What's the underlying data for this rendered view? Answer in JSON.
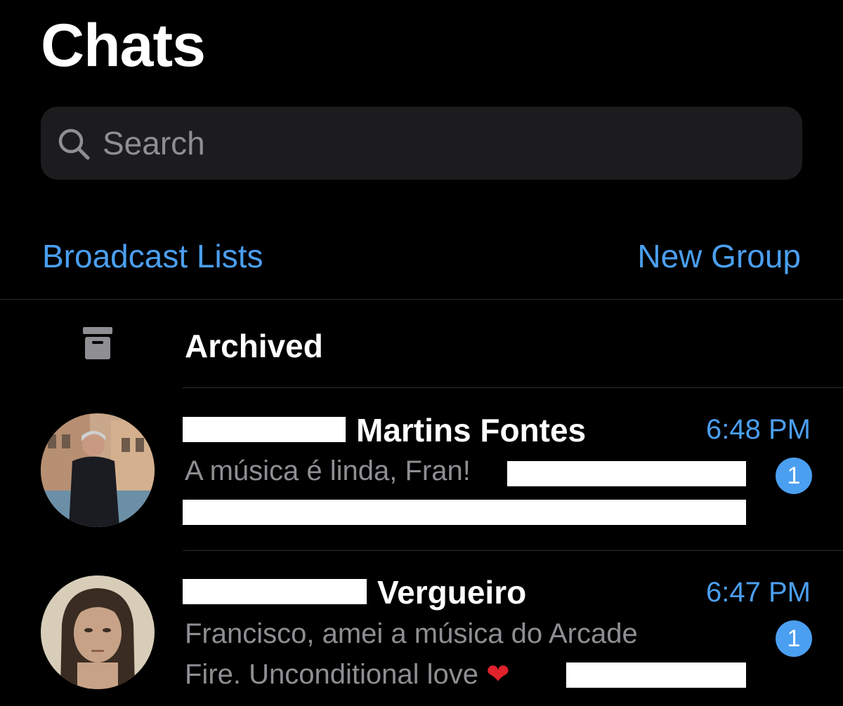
{
  "header": {
    "title": "Chats"
  },
  "search": {
    "placeholder": "Search"
  },
  "actions": {
    "broadcast_lists": "Broadcast Lists",
    "new_group": "New Group"
  },
  "archived": {
    "label": "Archived"
  },
  "chats": [
    {
      "name_visible": "Martins Fontes",
      "time": "6:48 PM",
      "preview_line1": "A música é linda, Fran!",
      "preview_line2": "",
      "unread": "1"
    },
    {
      "name_visible": "Vergueiro",
      "time": "6:47 PM",
      "preview_line1": "Francisco, amei a música do Arcade",
      "preview_line2": "Fire. Unconditional love",
      "preview_emoji": "❤",
      "unread": "1"
    }
  ],
  "colors": {
    "accent": "#4b9ff0",
    "background": "#000000",
    "search_bg": "#1c1c1e",
    "secondary_text": "#8e8e93"
  },
  "icons": {
    "search": "magnifier-icon",
    "archive": "archive-box-icon"
  }
}
